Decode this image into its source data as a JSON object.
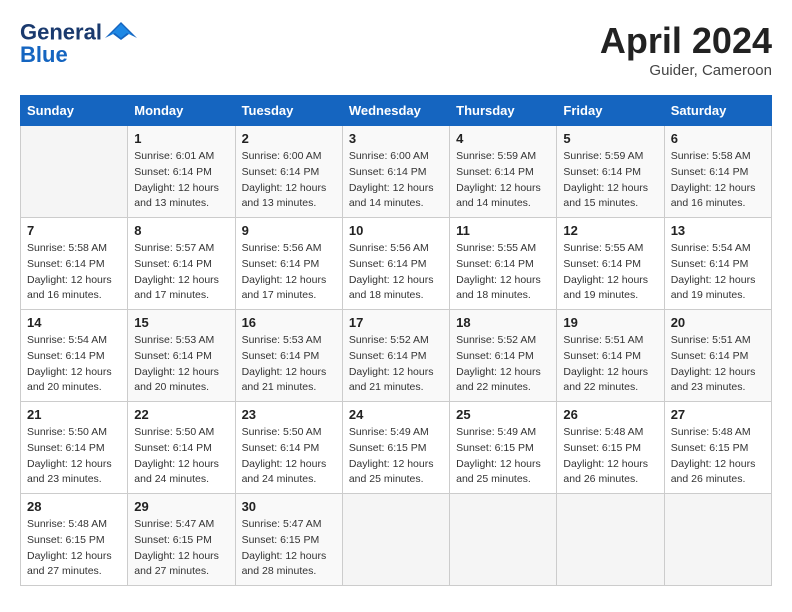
{
  "header": {
    "logo_line1": "General",
    "logo_line2": "Blue",
    "month": "April 2024",
    "location": "Guider, Cameroon"
  },
  "columns": [
    "Sunday",
    "Monday",
    "Tuesday",
    "Wednesday",
    "Thursday",
    "Friday",
    "Saturday"
  ],
  "weeks": [
    [
      {
        "day": "",
        "info": ""
      },
      {
        "day": "1",
        "info": "Sunrise: 6:01 AM\nSunset: 6:14 PM\nDaylight: 12 hours\nand 13 minutes."
      },
      {
        "day": "2",
        "info": "Sunrise: 6:00 AM\nSunset: 6:14 PM\nDaylight: 12 hours\nand 13 minutes."
      },
      {
        "day": "3",
        "info": "Sunrise: 6:00 AM\nSunset: 6:14 PM\nDaylight: 12 hours\nand 14 minutes."
      },
      {
        "day": "4",
        "info": "Sunrise: 5:59 AM\nSunset: 6:14 PM\nDaylight: 12 hours\nand 14 minutes."
      },
      {
        "day": "5",
        "info": "Sunrise: 5:59 AM\nSunset: 6:14 PM\nDaylight: 12 hours\nand 15 minutes."
      },
      {
        "day": "6",
        "info": "Sunrise: 5:58 AM\nSunset: 6:14 PM\nDaylight: 12 hours\nand 16 minutes."
      }
    ],
    [
      {
        "day": "7",
        "info": "Sunrise: 5:58 AM\nSunset: 6:14 PM\nDaylight: 12 hours\nand 16 minutes."
      },
      {
        "day": "8",
        "info": "Sunrise: 5:57 AM\nSunset: 6:14 PM\nDaylight: 12 hours\nand 17 minutes."
      },
      {
        "day": "9",
        "info": "Sunrise: 5:56 AM\nSunset: 6:14 PM\nDaylight: 12 hours\nand 17 minutes."
      },
      {
        "day": "10",
        "info": "Sunrise: 5:56 AM\nSunset: 6:14 PM\nDaylight: 12 hours\nand 18 minutes."
      },
      {
        "day": "11",
        "info": "Sunrise: 5:55 AM\nSunset: 6:14 PM\nDaylight: 12 hours\nand 18 minutes."
      },
      {
        "day": "12",
        "info": "Sunrise: 5:55 AM\nSunset: 6:14 PM\nDaylight: 12 hours\nand 19 minutes."
      },
      {
        "day": "13",
        "info": "Sunrise: 5:54 AM\nSunset: 6:14 PM\nDaylight: 12 hours\nand 19 minutes."
      }
    ],
    [
      {
        "day": "14",
        "info": "Sunrise: 5:54 AM\nSunset: 6:14 PM\nDaylight: 12 hours\nand 20 minutes."
      },
      {
        "day": "15",
        "info": "Sunrise: 5:53 AM\nSunset: 6:14 PM\nDaylight: 12 hours\nand 20 minutes."
      },
      {
        "day": "16",
        "info": "Sunrise: 5:53 AM\nSunset: 6:14 PM\nDaylight: 12 hours\nand 21 minutes."
      },
      {
        "day": "17",
        "info": "Sunrise: 5:52 AM\nSunset: 6:14 PM\nDaylight: 12 hours\nand 21 minutes."
      },
      {
        "day": "18",
        "info": "Sunrise: 5:52 AM\nSunset: 6:14 PM\nDaylight: 12 hours\nand 22 minutes."
      },
      {
        "day": "19",
        "info": "Sunrise: 5:51 AM\nSunset: 6:14 PM\nDaylight: 12 hours\nand 22 minutes."
      },
      {
        "day": "20",
        "info": "Sunrise: 5:51 AM\nSunset: 6:14 PM\nDaylight: 12 hours\nand 23 minutes."
      }
    ],
    [
      {
        "day": "21",
        "info": "Sunrise: 5:50 AM\nSunset: 6:14 PM\nDaylight: 12 hours\nand 23 minutes."
      },
      {
        "day": "22",
        "info": "Sunrise: 5:50 AM\nSunset: 6:14 PM\nDaylight: 12 hours\nand 24 minutes."
      },
      {
        "day": "23",
        "info": "Sunrise: 5:50 AM\nSunset: 6:14 PM\nDaylight: 12 hours\nand 24 minutes."
      },
      {
        "day": "24",
        "info": "Sunrise: 5:49 AM\nSunset: 6:15 PM\nDaylight: 12 hours\nand 25 minutes."
      },
      {
        "day": "25",
        "info": "Sunrise: 5:49 AM\nSunset: 6:15 PM\nDaylight: 12 hours\nand 25 minutes."
      },
      {
        "day": "26",
        "info": "Sunrise: 5:48 AM\nSunset: 6:15 PM\nDaylight: 12 hours\nand 26 minutes."
      },
      {
        "day": "27",
        "info": "Sunrise: 5:48 AM\nSunset: 6:15 PM\nDaylight: 12 hours\nand 26 minutes."
      }
    ],
    [
      {
        "day": "28",
        "info": "Sunrise: 5:48 AM\nSunset: 6:15 PM\nDaylight: 12 hours\nand 27 minutes."
      },
      {
        "day": "29",
        "info": "Sunrise: 5:47 AM\nSunset: 6:15 PM\nDaylight: 12 hours\nand 27 minutes."
      },
      {
        "day": "30",
        "info": "Sunrise: 5:47 AM\nSunset: 6:15 PM\nDaylight: 12 hours\nand 28 minutes."
      },
      {
        "day": "",
        "info": ""
      },
      {
        "day": "",
        "info": ""
      },
      {
        "day": "",
        "info": ""
      },
      {
        "day": "",
        "info": ""
      }
    ]
  ]
}
